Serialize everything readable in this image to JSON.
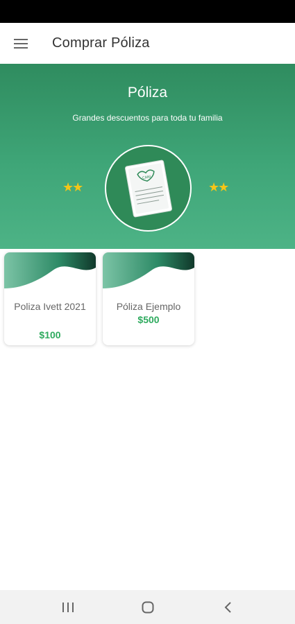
{
  "header": {
    "title": "Comprar Póliza",
    "menu_icon": "hamburger-menu-icon"
  },
  "hero": {
    "title": "Póliza",
    "subtitle": "Grandes descuentos para toda tu familia",
    "stars_left": "★★",
    "stars_right": "★★",
    "emblem_icon": "policy-document-icon"
  },
  "policies": [
    {
      "name": "Poliza Ivett 2021",
      "price": "$100"
    },
    {
      "name": "Póliza Ejemplo",
      "price": "$500"
    }
  ],
  "colors": {
    "primary_green": "#3fa678",
    "dark_green": "#1f6b4a",
    "price_green": "#2eaa5e",
    "star": "#f5c518"
  },
  "system_nav": {
    "recent_icon": "recent-apps-icon",
    "home_icon": "home-icon",
    "back_icon": "back-icon"
  }
}
